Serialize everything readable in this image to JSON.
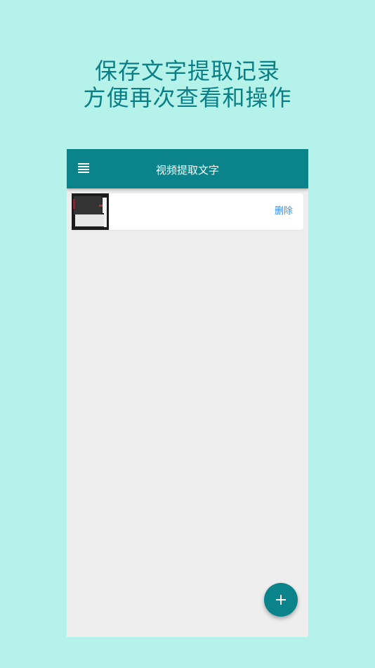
{
  "promo": {
    "line1": "保存文字提取记录",
    "line2": "方便再次查看和操作"
  },
  "app_bar": {
    "menu_icon": "menu-icon",
    "title": "视频提取文字"
  },
  "records": [
    {
      "thumbnail_icon": "video-thumbnail",
      "delete_label": "删除"
    }
  ],
  "fab": {
    "icon": "plus-icon"
  },
  "colors": {
    "background": "#b5f3ea",
    "promo_text": "#0a7f86",
    "app_bar": "#0a838a",
    "content_background": "#eeeeee",
    "delete_link": "#3f8fd6",
    "fab": "#0a838a"
  }
}
